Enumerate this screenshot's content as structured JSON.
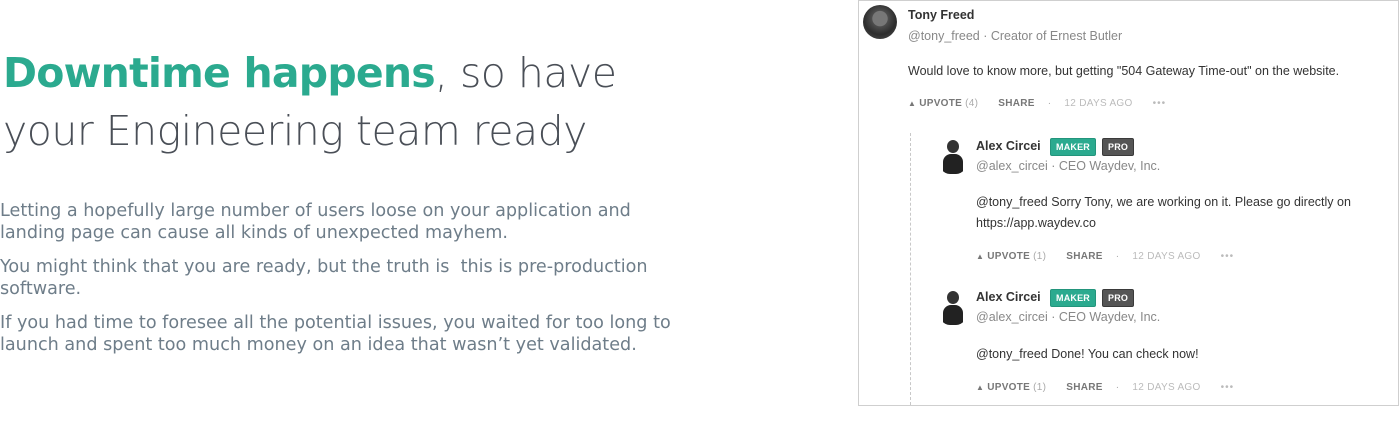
{
  "article": {
    "headline_accent": "Downtime happens",
    "headline_rest_1": ", so have",
    "headline_rest_2": "your Engineering team ready",
    "paragraphs": [
      "Letting a hopefully large number of users loose on your application and landing page can cause all kinds of unexpected mayhem.",
      "You might think that you are ready, but the truth is  this is pre-production software.",
      "If you had time to foresee all the potential issues, you waited for too long to launch and spent too much money on an idea that wasn’t yet validated."
    ]
  },
  "thread": {
    "comment": {
      "name": "Tony Freed",
      "handle": "@tony_freed · Creator of Ernest Butler",
      "text": "Would love to know more, but getting \"504 Gateway Time-out\" on the website.",
      "upvote_label": "UPVOTE",
      "upvote_count": "(4)",
      "share_label": "SHARE",
      "dot": "·",
      "age": "12 DAYS AGO",
      "more": "•••"
    },
    "replies": [
      {
        "name": "Alex Circei",
        "badge_maker": "MAKER",
        "badge_pro": "PRO",
        "handle": "@alex_circei · CEO Waydev, Inc.",
        "text_line1": "@tony_freed Sorry Tony, we are working on it. Please go directly on",
        "text_line2": "https://app.waydev.co",
        "upvote_label": "UPVOTE",
        "upvote_count": "(1)",
        "share_label": "SHARE",
        "dot": "·",
        "age": "12 DAYS AGO",
        "more": "•••"
      },
      {
        "name": "Alex Circei",
        "badge_maker": "MAKER",
        "badge_pro": "PRO",
        "handle": "@alex_circei · CEO Waydev, Inc.",
        "text_line1": "@tony_freed Done! You can check now!",
        "upvote_label": "UPVOTE",
        "upvote_count": "(1)",
        "share_label": "SHARE",
        "dot": "·",
        "age": "12 DAYS AGO",
        "more": "•••"
      }
    ]
  },
  "colors": {
    "accent": "#2baa8f",
    "headline": "#4a4f57",
    "body": "#6e7d89",
    "badge_pro": "#555555"
  },
  "icons": {
    "upvote": "triangle-up-icon",
    "more": "ellipsis-icon"
  }
}
